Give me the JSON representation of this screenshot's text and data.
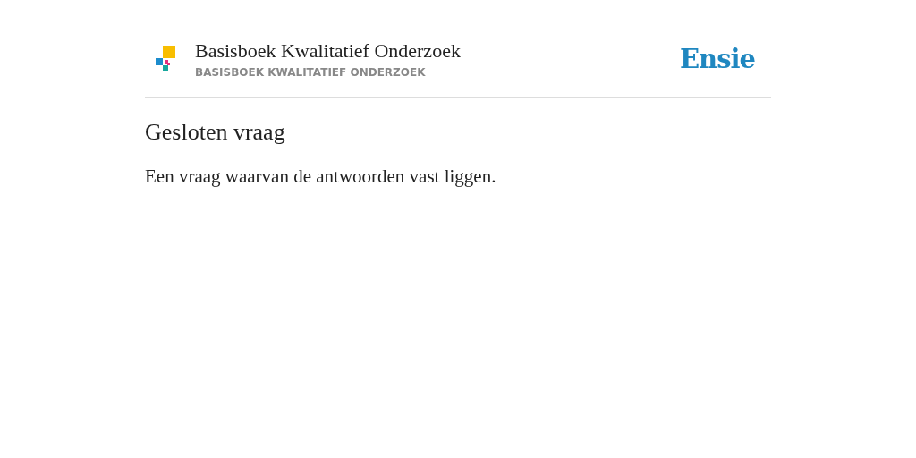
{
  "header": {
    "title": "Basisboek Kwalitatief Onderzoek",
    "subtitle": "BASISBOEK KWALITATIEF ONDERZOEK",
    "brand": "Ensie"
  },
  "entry": {
    "term": "Gesloten vraag",
    "definition": "Een vraag waarvan de antwoorden vast liggen."
  }
}
